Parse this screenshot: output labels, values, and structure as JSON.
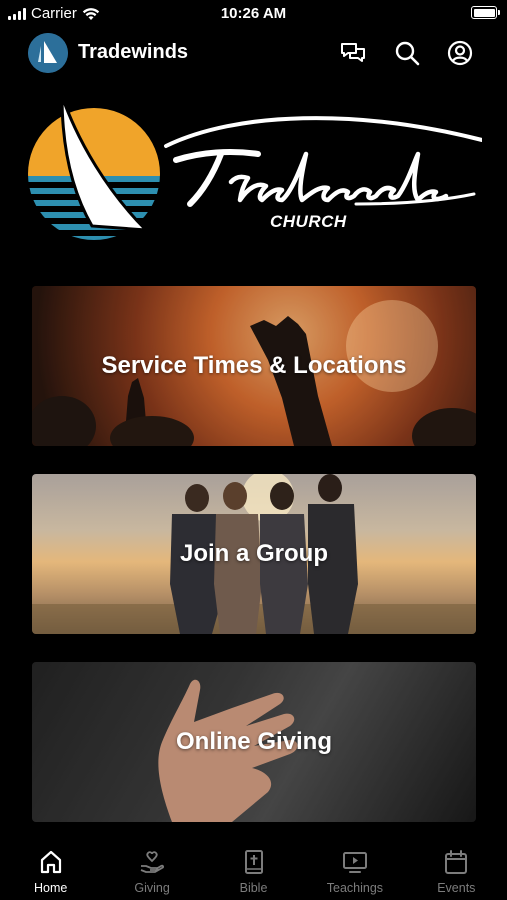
{
  "status_bar": {
    "carrier": "Carrier",
    "time": "10:26 AM"
  },
  "header": {
    "title": "Tradewinds",
    "actions": [
      {
        "name": "chat-icon"
      },
      {
        "name": "search-icon"
      },
      {
        "name": "profile-icon"
      }
    ]
  },
  "logo": {
    "name": "Tradewinds",
    "subtitle": "CHURCH"
  },
  "cards": [
    {
      "label": "Service Times & Locations"
    },
    {
      "label": "Join a Group"
    },
    {
      "label": "Online Giving"
    }
  ],
  "tabs": [
    {
      "label": "Home",
      "icon": "home-icon",
      "active": true
    },
    {
      "label": "Giving",
      "icon": "giving-hand-icon",
      "active": false
    },
    {
      "label": "Bible",
      "icon": "bible-icon",
      "active": false
    },
    {
      "label": "Teachings",
      "icon": "video-icon",
      "active": false
    },
    {
      "label": "Events",
      "icon": "calendar-icon",
      "active": false
    }
  ],
  "colors": {
    "background": "#000000",
    "sun": "#f0a42a",
    "water": "#2d8fb0",
    "tab_inactive": "#7c7c7c"
  }
}
